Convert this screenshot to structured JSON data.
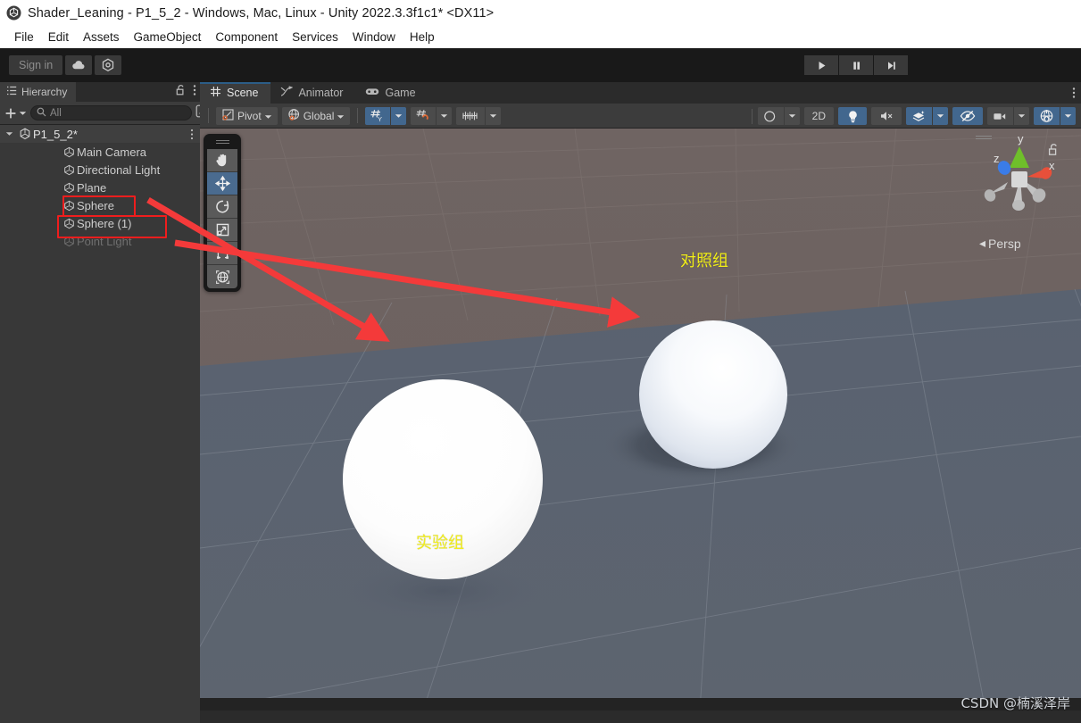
{
  "window": {
    "title": "Shader_Leaning - P1_5_2 - Windows, Mac, Linux - Unity 2022.3.3f1c1* <DX11>",
    "logo_icon": "unity-logo-icon"
  },
  "menubar": {
    "items": [
      {
        "label": "File"
      },
      {
        "label": "Edit"
      },
      {
        "label": "Assets"
      },
      {
        "label": "GameObject"
      },
      {
        "label": "Component"
      },
      {
        "label": "Services"
      },
      {
        "label": "Window"
      },
      {
        "label": "Help"
      }
    ]
  },
  "toolbar": {
    "signin_label": "Sign in",
    "cloud_icon": "cloud-icon",
    "settings_icon": "unity-services-icon",
    "play_icon": "play-icon",
    "pause_icon": "pause-icon",
    "step_icon": "step-forward-icon"
  },
  "hierarchy": {
    "tab_label": "Hierarchy",
    "tab_icon": "hierarchy-icon",
    "lock_icon": "lock-open-icon",
    "menu_icon": "kebab-menu-icon",
    "add_label": "+",
    "add_icon": "plus-icon",
    "dropdown_icon": "chevron-down-icon",
    "search": {
      "value": "",
      "placeholder": "All",
      "icon": "search-icon"
    },
    "expand_icon": "expand-window-icon",
    "scene_name": "P1_5_2*",
    "scene_icon": "unity-scene-icon",
    "items": [
      {
        "label": "Main Camera",
        "icon": "gameobject-icon",
        "dim": false,
        "highlighted": false
      },
      {
        "label": "Directional Light",
        "icon": "gameobject-icon",
        "dim": false,
        "highlighted": false
      },
      {
        "label": "Plane",
        "icon": "gameobject-icon",
        "dim": false,
        "highlighted": false
      },
      {
        "label": "Sphere",
        "icon": "gameobject-icon",
        "dim": false,
        "highlighted": true
      },
      {
        "label": "Sphere (1)",
        "icon": "gameobject-icon",
        "dim": false,
        "highlighted": true
      },
      {
        "label": "Point Light",
        "icon": "gameobject-icon",
        "dim": true,
        "highlighted": false
      }
    ]
  },
  "scene_tabs": [
    {
      "label": "Scene",
      "icon": "scene-grid-icon",
      "active": true
    },
    {
      "label": "Animator",
      "icon": "animator-icon",
      "active": false
    },
    {
      "label": "Game",
      "icon": "gamepad-icon",
      "active": false
    }
  ],
  "scene_panel_menu_icon": "kebab-menu-icon",
  "scene_toolbar": {
    "pivot_label": "Pivot",
    "pivot_icon": "pivot-icon",
    "global_label": "Global",
    "global_icon": "globe-icon",
    "grid_snap_icon": "grid-axis-y-icon",
    "grid_snap_on": true,
    "magnet_snap_icon": "grid-magnet-icon",
    "increment_snap_icon": "increment-snap-icon",
    "dropdown_icon": "chevron-down-icon",
    "right_controls": [
      {
        "name": "shading-mode-icon",
        "label": "",
        "on": false,
        "has_arrow": true
      },
      {
        "name": "2d-toggle",
        "label": "2D",
        "on": false,
        "has_arrow": false
      },
      {
        "name": "scene-lighting-icon",
        "label": "",
        "on": true,
        "has_arrow": false
      },
      {
        "name": "scene-audio-muted-icon",
        "label": "",
        "on": false,
        "has_arrow": false
      },
      {
        "name": "scene-fx-icon",
        "label": "",
        "on": true,
        "has_arrow": true
      },
      {
        "name": "scene-visibility-off-icon",
        "label": "",
        "on": true,
        "has_arrow": false
      },
      {
        "name": "camera-overlay-icon",
        "label": "",
        "on": false,
        "has_arrow": true
      },
      {
        "name": "gizmos-icon",
        "label": "",
        "on": true,
        "has_arrow": true
      }
    ]
  },
  "scene_tools": [
    {
      "name": "hand-tool",
      "icon": "hand-icon",
      "active": false
    },
    {
      "name": "move-tool",
      "icon": "move-icon",
      "active": true
    },
    {
      "name": "rotate-tool",
      "icon": "rotate-icon",
      "active": false
    },
    {
      "name": "scale-tool",
      "icon": "scale-icon",
      "active": false
    },
    {
      "name": "rect-tool",
      "icon": "rect-transform-icon",
      "active": false
    },
    {
      "name": "transform-tool",
      "icon": "transform-icon",
      "active": false
    }
  ],
  "gizmo": {
    "x_label": "x",
    "y_label": "y",
    "z_label": "z",
    "projection_label": "Persp",
    "lock_icon": "lock-open-icon",
    "x_color": "#e8503a",
    "y_color": "#6fbf2a",
    "z_color": "#3a7ce8"
  },
  "annotations": {
    "label_left": "实验组",
    "label_right": "对照组",
    "label_color": "#f2ef18",
    "box_color": "#ef1d1d",
    "arrow_color": "#f43a3a",
    "watermark": "CSDN @楠溪泽岸"
  },
  "viewport": {
    "sky_color": "#6d6260",
    "ground_color": "#5c6470",
    "left_sphere_name": "sphere-experimental",
    "right_sphere_name": "sphere-control"
  }
}
